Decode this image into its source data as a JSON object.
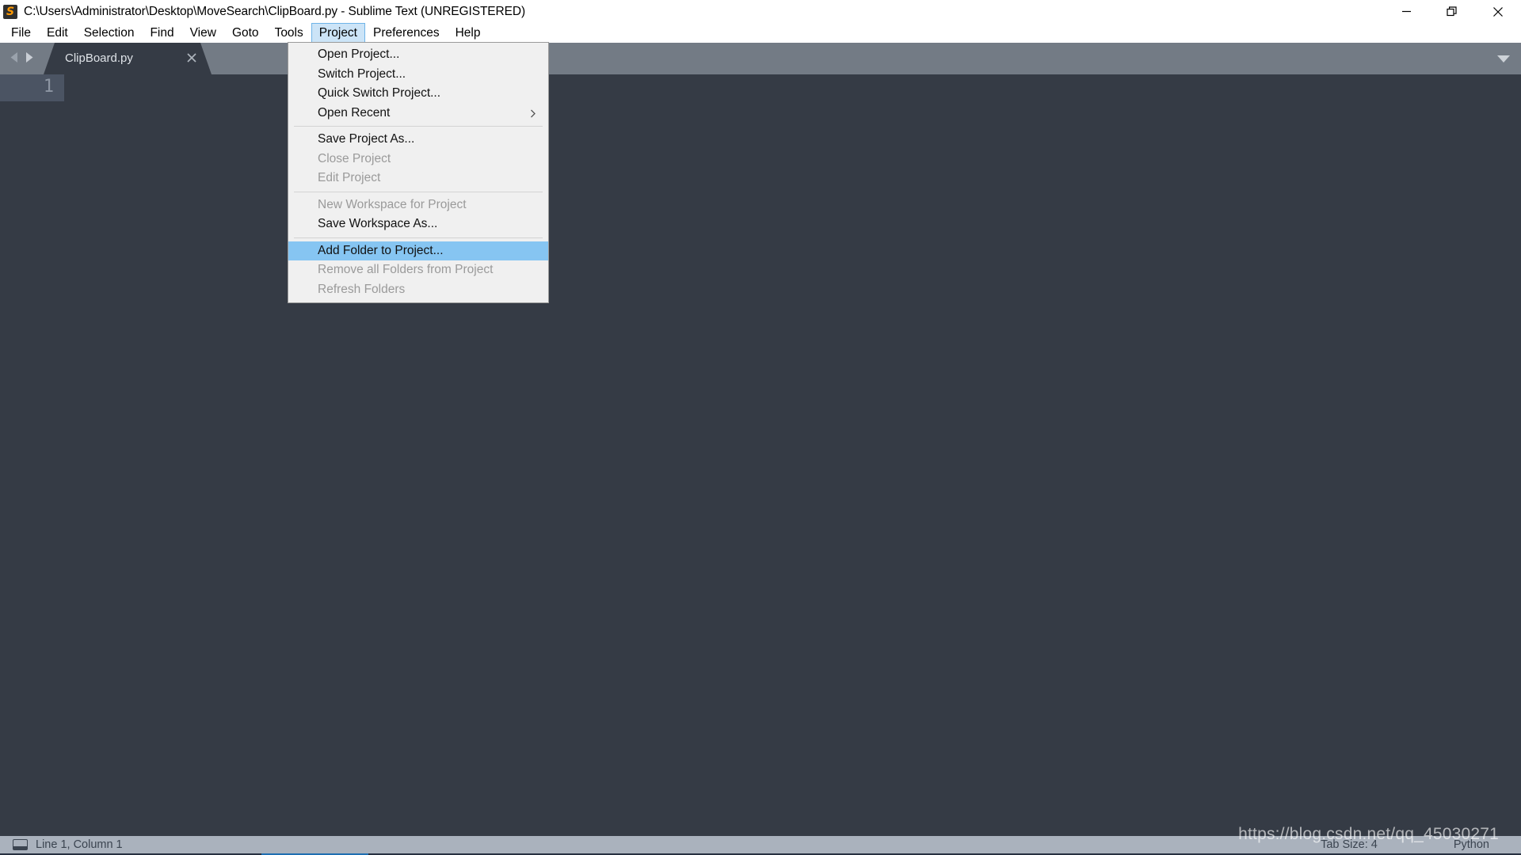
{
  "window": {
    "title": "C:\\Users\\Administrator\\Desktop\\MoveSearch\\ClipBoard.py - Sublime Text (UNREGISTERED)",
    "app_icon": "sublime-text-logo",
    "controls": {
      "minimize": "minimize-icon",
      "restore": "restore-icon",
      "close": "close-icon"
    }
  },
  "menubar": {
    "items": [
      {
        "label": "File",
        "active": false
      },
      {
        "label": "Edit",
        "active": false
      },
      {
        "label": "Selection",
        "active": false
      },
      {
        "label": "Find",
        "active": false
      },
      {
        "label": "View",
        "active": false
      },
      {
        "label": "Goto",
        "active": false
      },
      {
        "label": "Tools",
        "active": false
      },
      {
        "label": "Project",
        "active": true
      },
      {
        "label": "Preferences",
        "active": false
      },
      {
        "label": "Help",
        "active": false
      }
    ]
  },
  "project_menu": {
    "items": [
      {
        "label": "Open Project...",
        "state": "normal",
        "submenu": false
      },
      {
        "label": "Switch Project...",
        "state": "normal",
        "submenu": false
      },
      {
        "label": "Quick Switch Project...",
        "state": "normal",
        "submenu": false
      },
      {
        "label": "Open Recent",
        "state": "normal",
        "submenu": true
      },
      {
        "separator": true
      },
      {
        "label": "Save Project As...",
        "state": "normal",
        "submenu": false
      },
      {
        "label": "Close Project",
        "state": "disabled",
        "submenu": false
      },
      {
        "label": "Edit Project",
        "state": "disabled",
        "submenu": false
      },
      {
        "separator": true
      },
      {
        "label": "New Workspace for Project",
        "state": "disabled",
        "submenu": false
      },
      {
        "label": "Save Workspace As...",
        "state": "normal",
        "submenu": false
      },
      {
        "separator": true
      },
      {
        "label": "Add Folder to Project...",
        "state": "highlighted",
        "submenu": false
      },
      {
        "label": "Remove all Folders from Project",
        "state": "disabled",
        "submenu": false
      },
      {
        "label": "Refresh Folders",
        "state": "disabled",
        "submenu": false
      }
    ]
  },
  "tabbar": {
    "nav_prev": "arrow-left-icon",
    "nav_next": "arrow-right-icon",
    "tabs": [
      {
        "label": "ClipBoard.py",
        "active": true,
        "close_icon": "close-icon"
      }
    ],
    "overflow_menu": "chevron-down-icon"
  },
  "editor": {
    "line_numbers": [
      "1"
    ],
    "content": ""
  },
  "statusbar": {
    "left_icon": "console-icon",
    "cursor_position": "Line 1, Column 1",
    "tab_size": "Tab Size: 4",
    "syntax": "Python"
  },
  "watermark": {
    "text": "https://blog.csdn.net/qq_45030271"
  },
  "colors": {
    "titlebar_bg": "#ffffff",
    "menu_active_bg": "#cce4f7",
    "menu_active_border": "#6fb4e8",
    "dropdown_bg": "#f0f0f0",
    "dropdown_highlight": "#86c5f2",
    "tabbar_bg": "#737b85",
    "tab_active_bg": "#353b45",
    "editor_bg": "#353b45",
    "gutter_bg": "#4b5463",
    "statusbar_bg": "#aab2bd",
    "statusbar_text": "#3b4450",
    "scrollbar_thumb": "#1f6fb2",
    "logo_orange": "#ff9800"
  }
}
